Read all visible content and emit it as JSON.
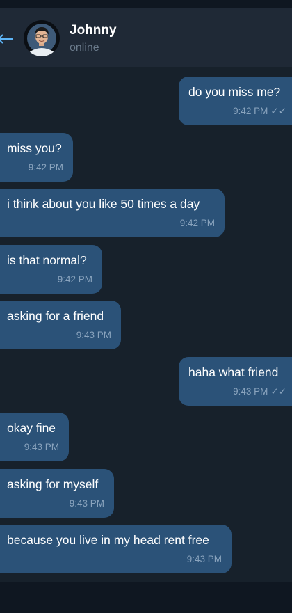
{
  "header": {
    "name": "Johnny",
    "status": "online"
  },
  "icons": {
    "back": "back-arrow-icon",
    "avatar": "profile-photo"
  },
  "colors": {
    "background": "#17212b",
    "header": "#1f2936",
    "bubble": "#2b5278",
    "accent": "#5eb5f7"
  },
  "messages": [
    {
      "direction": "out",
      "text": "do you miss me?",
      "time": "9:42 PM",
      "ticks": "✓✓"
    },
    {
      "direction": "in",
      "text": "miss you?",
      "time": "9:42 PM"
    },
    {
      "direction": "in",
      "text": "i think about you like 50 times a day",
      "time": "9:42 PM"
    },
    {
      "direction": "in",
      "text": "is that normal?",
      "time": "9:42 PM"
    },
    {
      "direction": "in",
      "text": "asking for a friend",
      "time": "9:43 PM"
    },
    {
      "direction": "out",
      "text": "haha what friend",
      "time": "9:43 PM",
      "ticks": "✓✓"
    },
    {
      "direction": "in",
      "text": "okay fine",
      "time": "9:43 PM"
    },
    {
      "direction": "in",
      "text": "asking for myself",
      "time": "9:43 PM"
    },
    {
      "direction": "in",
      "text": "because you live in my head rent free",
      "time": "9:43 PM"
    }
  ]
}
